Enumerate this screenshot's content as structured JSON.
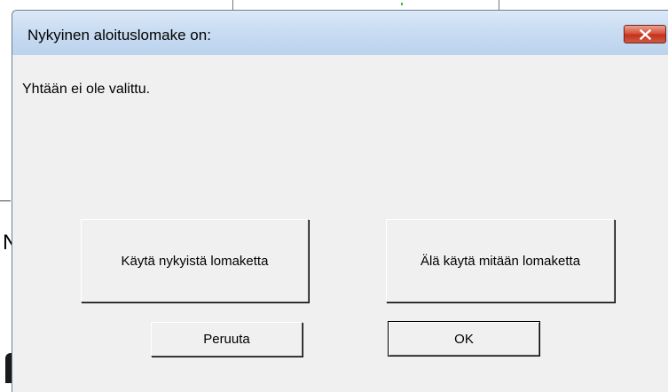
{
  "dialog": {
    "title": "Nykyinen aloituslomake on:",
    "message": "Yhtään ei ole valittu.",
    "buttons": {
      "use_current": "Käytä nykyistä lomaketta",
      "use_none": "Älä käytä mitään lomaketta",
      "cancel": "Peruuta",
      "ok": "OK"
    },
    "close_icon": "close-x-icon",
    "accent_colors": {
      "titlebar": "#c9dcf2",
      "close_button": "#d9533c",
      "face": "#f0f0f0"
    }
  },
  "background": {
    "left_glyph": "N"
  }
}
